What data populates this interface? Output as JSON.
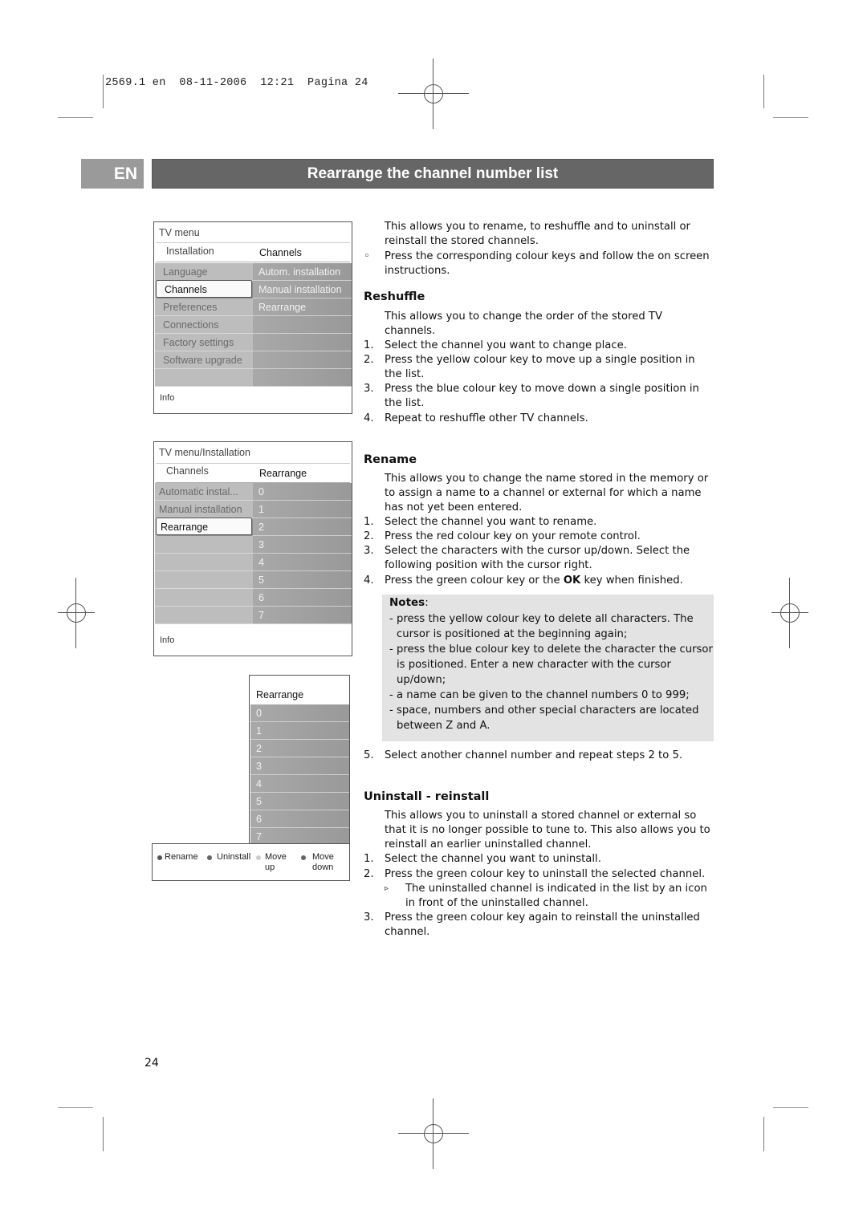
{
  "slug": "2569.1 en  08-11-2006  12:21  Pagina 24",
  "header": {
    "language_tab": "EN",
    "title": "Rearrange the channel number list"
  },
  "menu1": {
    "breadcrumb": "TV menu",
    "left_header": "Installation",
    "right_header": "Channels",
    "left_items": [
      "Language",
      "Channels",
      "Preferences",
      "Connections",
      "Factory settings",
      "Software upgrade",
      ""
    ],
    "selected_left": "Channels",
    "right_items": [
      "Autom. installation",
      "Manual installation",
      "Rearrange",
      "",
      "",
      "",
      ""
    ],
    "info": "Info"
  },
  "menu2": {
    "breadcrumb": "TV menu/Installation",
    "left_header": "Channels",
    "right_header": "Rearrange",
    "left_items": [
      "Automatic instal...",
      "Manual installation",
      "Rearrange",
      "",
      "",
      "",
      "",
      ""
    ],
    "selected_left": "Rearrange",
    "right_items": [
      "0",
      "1",
      "2",
      "3",
      "4",
      "5",
      "6",
      "7"
    ],
    "info": "Info"
  },
  "menu3": {
    "header": "Rearrange",
    "items": [
      "0",
      "1",
      "2",
      "3",
      "4",
      "5",
      "6",
      "7"
    ],
    "legend": [
      {
        "label": "Rename",
        "color": "#555555",
        "icon": "red-key-icon"
      },
      {
        "label": "Uninstall",
        "color": "#666666",
        "icon": "green-key-icon"
      },
      {
        "label": "Move up",
        "color": "#cccccc",
        "icon": "yellow-key-icon"
      },
      {
        "label": "Move down",
        "color": "#666666",
        "icon": "blue-key-icon"
      }
    ]
  },
  "intro": {
    "text": "This allows you to rename, to reshuffle and to uninstall or reinstall the stored channels.",
    "bullet_symbol": "◦",
    "bullet": "Press the corresponding colour keys and follow the on screen instructions."
  },
  "reshuffle": {
    "heading": "Reshuffle",
    "text": "This allows you to change the order of the stored TV channels.",
    "steps": [
      {
        "n": "1.",
        "t": "Select the channel you want to change place."
      },
      {
        "n": "2.",
        "t": "Press the yellow colour key  to move up a single position in the list."
      },
      {
        "n": "3.",
        "t": "Press the blue colour key to move down a single position in the list."
      },
      {
        "n": "4.",
        "t": "Repeat to reshuffle other TV channels."
      }
    ]
  },
  "rename": {
    "heading": "Rename",
    "text": "This allows you to change the name stored in the memory or to assign a name to a channel or external for which a name has not yet been entered.",
    "steps": [
      {
        "n": "1.",
        "t": "Select the channel you want to rename."
      },
      {
        "n": "2.",
        "t": "Press the red colour key on your remote control."
      },
      {
        "n": "3.",
        "t": "Select the characters with the cursor up/down. Select the following position with the cursor right."
      },
      {
        "n": "4.",
        "t_before": "Press the green colour key or the ",
        "t_bold": "OK",
        "t_after": " key when finished."
      }
    ],
    "notes_heading": "Notes",
    "notes_colon": ":",
    "notes": [
      "- press the yellow colour key to delete all characters. The cursor is positioned at the beginning again;",
      "- press the blue colour key to delete the character the cursor is positioned. Enter a new character with the cursor up/down;",
      "- a name can be given to the channel numbers 0 to 999;",
      "- space, numbers and other special characters are located between Z and A."
    ],
    "step5": {
      "n": "5.",
      "t": "Select another channel number and repeat steps 2 to 5."
    }
  },
  "uninstall": {
    "heading": "Uninstall - reinstall",
    "text": "This allows you to uninstall a stored channel or external so that it is no longer possible to tune to. This also allows you to reinstall an earlier uninstalled channel.",
    "steps": [
      {
        "n": "1.",
        "t": "Select the channel you want to uninstall."
      },
      {
        "n": "2.",
        "t": "Press the green colour key to uninstall the selected channel."
      },
      {
        "n": "3.",
        "t": "Press the green colour key again to reinstall the uninstalled channel."
      }
    ],
    "sub_symbol": "▹",
    "sub": "The uninstalled channel is indicated in the list by an icon in front of the uninstalled channel."
  },
  "page_number": "24"
}
